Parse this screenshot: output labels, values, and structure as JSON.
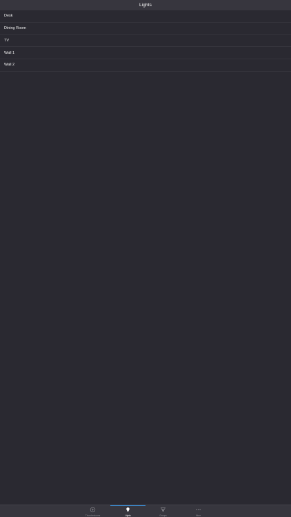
{
  "header": {
    "title": "Lights"
  },
  "lights": [
    {
      "label": "Desk"
    },
    {
      "label": "Dining Room"
    },
    {
      "label": "TV"
    },
    {
      "label": "Wall 1"
    },
    {
      "label": "Wall 2"
    }
  ],
  "tabbar": {
    "tabs": [
      {
        "label": "Thunderstorms",
        "icon": "thunderstorm-icon"
      },
      {
        "label": "Lights",
        "icon": "lightbulb-icon",
        "active": true
      },
      {
        "label": "Groups",
        "icon": "groups-icon"
      },
      {
        "label": "More",
        "icon": "more-icon"
      }
    ]
  },
  "colors": {
    "background": "#2a2931",
    "bar": "#37363e",
    "accent": "#3a8fd8",
    "inactive": "#8f8e94"
  }
}
